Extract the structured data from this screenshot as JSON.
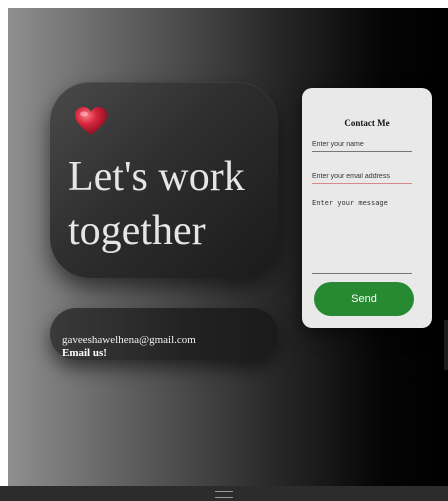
{
  "hero": {
    "icon": "heart-icon",
    "title": "Let's work together"
  },
  "contact": {
    "email": "gaveeshawelhena@gmail.com",
    "cta": "Email us!"
  },
  "form": {
    "title": "Contact Me",
    "name_placeholder": "Enter your name",
    "email_placeholder": "Enter your email address",
    "message_placeholder": "Enter your message",
    "send_label": "Send"
  },
  "colors": {
    "accent": "#278a33",
    "heart": "#d7263d",
    "form_background": "#e9e9e9"
  }
}
